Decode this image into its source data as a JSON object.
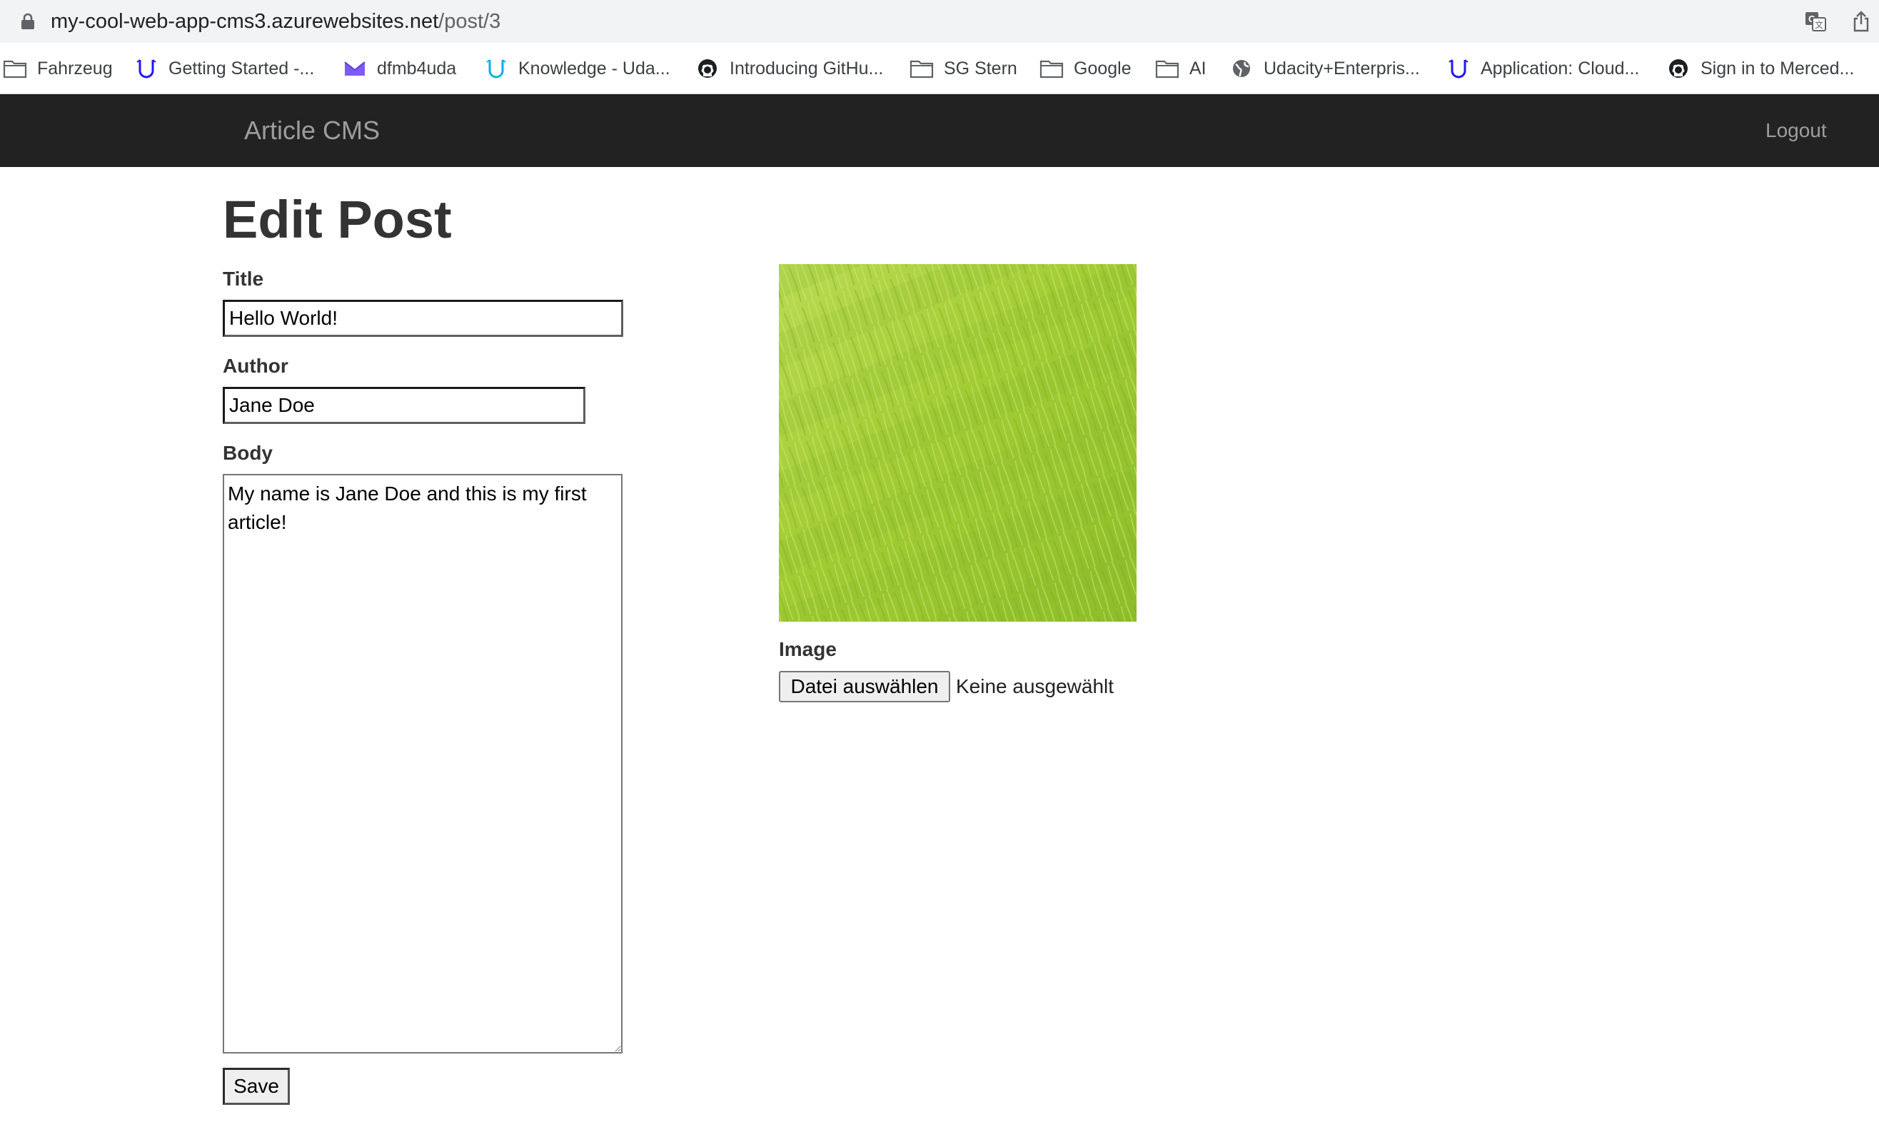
{
  "browser": {
    "url_host": "my-cool-web-app-cms3.azurewebsites.net",
    "url_path": "/post/3",
    "bookmarks": [
      {
        "label": "Fahrzeug",
        "icon": "folder-icon"
      },
      {
        "label": "Getting Started -...",
        "icon": "udacity-icon"
      },
      {
        "label": "dfmb4uda",
        "icon": "mail-icon"
      },
      {
        "label": "Knowledge - Uda...",
        "icon": "udacity-icon"
      },
      {
        "label": "Introducing GitHu...",
        "icon": "github-icon"
      },
      {
        "label": "SG Stern",
        "icon": "folder-icon"
      },
      {
        "label": "Google",
        "icon": "folder-icon"
      },
      {
        "label": "AI",
        "icon": "folder-icon"
      },
      {
        "label": "Udacity+Enterpris...",
        "icon": "globe-icon"
      },
      {
        "label": "Application: Cloud...",
        "icon": "udacity-icon"
      },
      {
        "label": "Sign in to Merced...",
        "icon": "github-icon"
      }
    ]
  },
  "navbar": {
    "brand": "Article CMS",
    "logout": "Logout"
  },
  "page": {
    "title": "Edit Post"
  },
  "form": {
    "title_label": "Title",
    "title_value": "Hello World!",
    "author_label": "Author",
    "author_value": "Jane Doe",
    "body_label": "Body",
    "body_value": "My name is Jane Doe and this is my first article!",
    "image_label": "Image",
    "file_button": "Datei auswählen",
    "file_status": "Keine ausgewählt",
    "save_label": "Save"
  },
  "colors": {
    "navbar_bg": "#222222",
    "navbar_text": "#9d9d9d",
    "grass": "#a7cf3a"
  }
}
